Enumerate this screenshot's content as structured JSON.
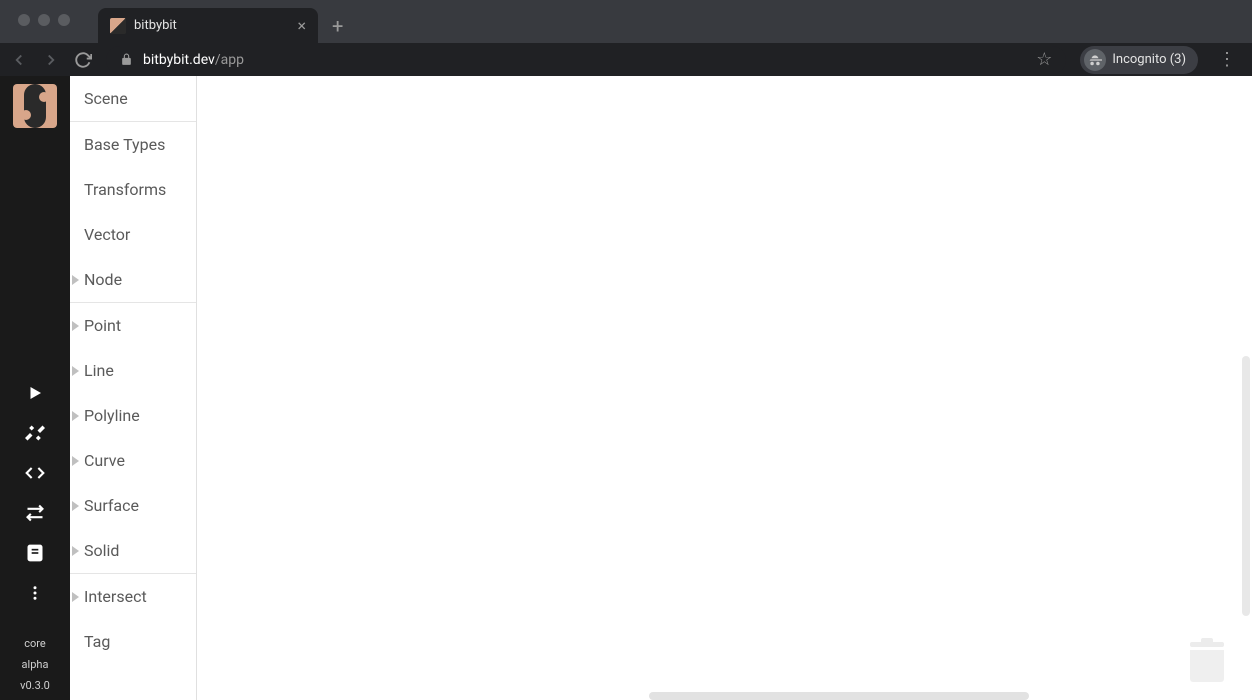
{
  "browser": {
    "tab_title": "bitbybit",
    "url_host": "bitbybit.dev",
    "url_path": "/app",
    "incognito_label": "Incognito (3)"
  },
  "rail": {
    "info1": "core",
    "info2": "alpha",
    "info3": "v0.3.0"
  },
  "panel": {
    "items": [
      {
        "label": "Scene",
        "arrow": false,
        "divider": true
      },
      {
        "label": "Base Types",
        "arrow": false,
        "divider": false
      },
      {
        "label": "Transforms",
        "arrow": false,
        "divider": false
      },
      {
        "label": "Vector",
        "arrow": false,
        "divider": false
      },
      {
        "label": "Node",
        "arrow": true,
        "divider": true
      },
      {
        "label": "Point",
        "arrow": true,
        "divider": false
      },
      {
        "label": "Line",
        "arrow": true,
        "divider": false
      },
      {
        "label": "Polyline",
        "arrow": true,
        "divider": false
      },
      {
        "label": "Curve",
        "arrow": true,
        "divider": false
      },
      {
        "label": "Surface",
        "arrow": true,
        "divider": false
      },
      {
        "label": "Solid",
        "arrow": true,
        "divider": true
      },
      {
        "label": "Intersect",
        "arrow": true,
        "divider": false
      },
      {
        "label": "Tag",
        "arrow": false,
        "divider": false
      }
    ]
  }
}
